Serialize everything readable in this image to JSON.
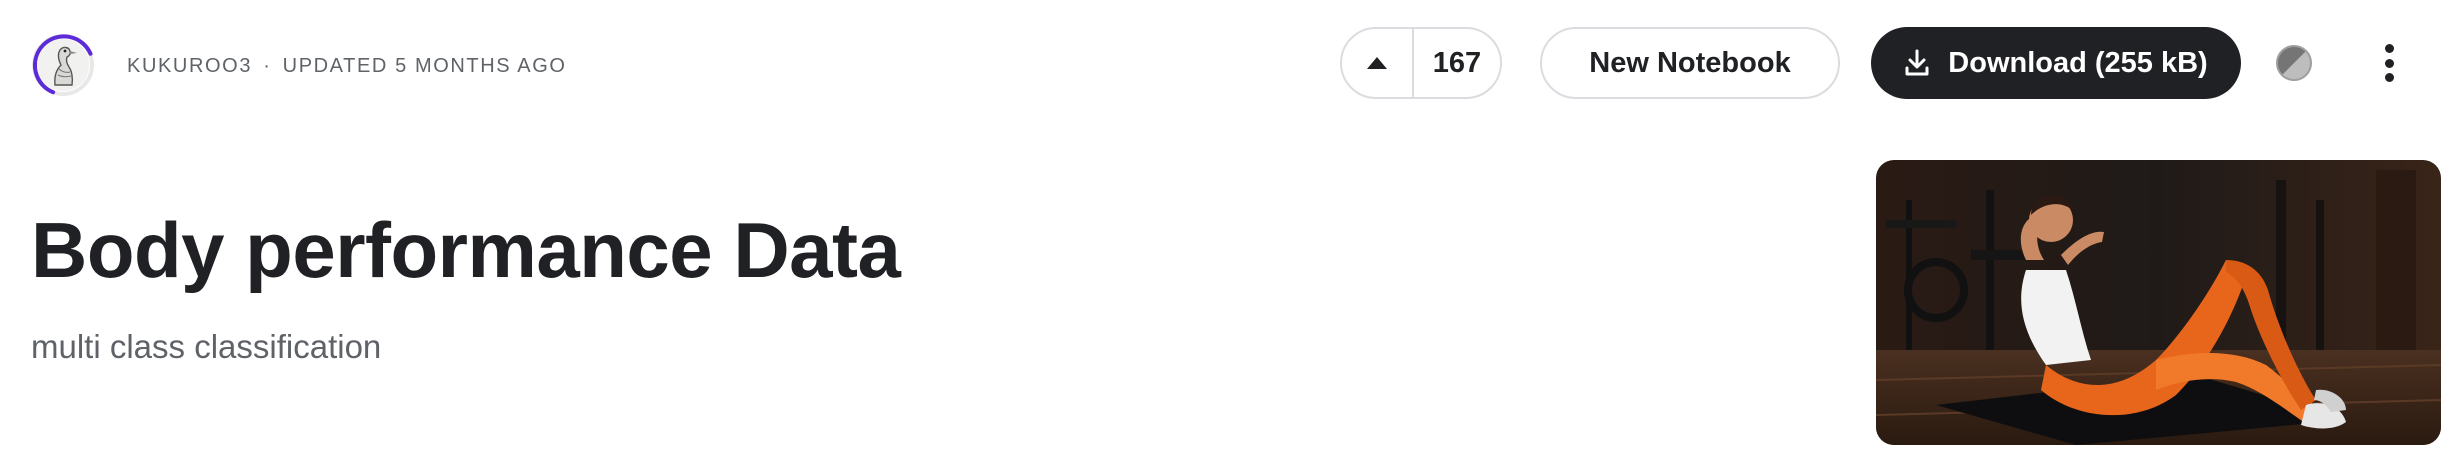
{
  "header": {
    "author": "KUKUROO3",
    "separator": "·",
    "updated": "UPDATED 5 MONTHS AGO",
    "avatar_icon": "ostrich-avatar",
    "ring_color": "#5c2bd8"
  },
  "votes": {
    "upvote_icon": "triangle-up-icon",
    "count": "167"
  },
  "actions": {
    "new_notebook_label": "New Notebook",
    "download_label": "Download (255 kB)",
    "download_icon": "download-icon",
    "theme_icon": "half-circle-icon",
    "more_icon": "vertical-dots-icon"
  },
  "dataset": {
    "title": "Body performance Data",
    "subtitle": "multi class classification",
    "cover_alt": "woman in orange leggings doing sit-ups on a mat in a gym"
  },
  "colors": {
    "primary_button": "#202124",
    "border": "#dadce0",
    "muted_text": "#5f6368",
    "accent_orange": "#e8661c"
  }
}
